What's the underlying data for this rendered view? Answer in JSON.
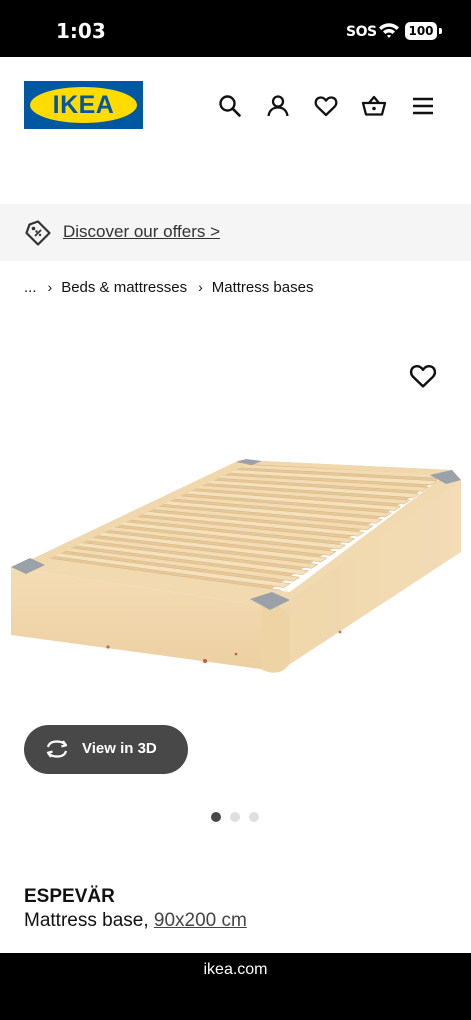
{
  "status_bar": {
    "time": "1:03",
    "sos": "SOS",
    "battery": "100"
  },
  "header": {
    "logo_text": "IKEA",
    "icons": [
      "search-icon",
      "account-icon",
      "heart-icon",
      "basket-icon",
      "menu-icon"
    ]
  },
  "offer": {
    "link_text": "Discover our offers >"
  },
  "breadcrumb": {
    "items": [
      "...",
      "Beds & mattresses",
      "Mattress bases"
    ]
  },
  "gallery": {
    "view3d_label": "View in 3D",
    "dot_count": 3,
    "active_dot": 0
  },
  "product": {
    "name": "ESPEVÄR",
    "description": "Mattress base,",
    "size": "90x200 cm"
  },
  "browser": {
    "url": "ikea.com"
  },
  "colors": {
    "ikea_blue": "#0058a3",
    "ikea_yellow": "#ffdb00",
    "offer_bg": "#f5f5f5",
    "button_dark": "#484848"
  }
}
